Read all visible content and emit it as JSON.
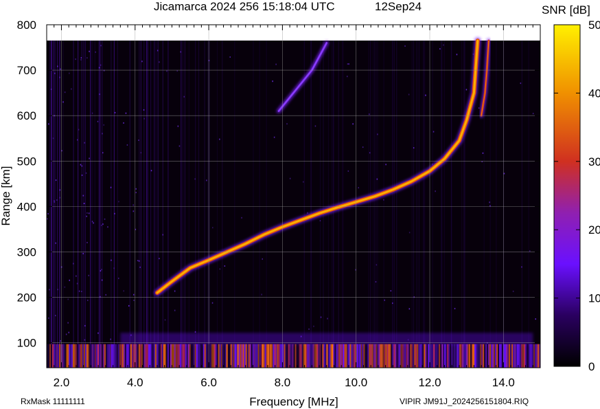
{
  "header": {
    "title": "Jicamarca 2024 256 15:18:04 UTC",
    "date": "12Sep24"
  },
  "footer": {
    "left": "RxMask 11111111",
    "right": "VIPIR  JM91J_2024256151804.RIQ"
  },
  "colorbar": {
    "label": "SNR [dB]",
    "range": [
      0,
      50
    ],
    "ticks": [
      "0",
      "10",
      "20",
      "30",
      "40",
      "50"
    ],
    "colors": [
      "#000000",
      "#2a0060",
      "#6a10ff",
      "#9020b0",
      "#d03020",
      "#f09000",
      "#fff000"
    ]
  },
  "chart_data": {
    "type": "heatmap",
    "title": "Jicamarca 2024 256 15:18:04 UTC",
    "xlabel": "Frequency [MHz]",
    "ylabel": "Range [km]",
    "xlim": [
      1.6,
      15.0
    ],
    "ylim": [
      45,
      800
    ],
    "x_ticks": [
      "2.0",
      "4.0",
      "6.0",
      "8.0",
      "10.0",
      "12.0",
      "14.0"
    ],
    "y_ticks": [
      "100",
      "200",
      "300",
      "400",
      "500",
      "600",
      "700",
      "800"
    ],
    "grid": true,
    "o_trace": {
      "x": [
        4.6,
        5.0,
        5.5,
        6.0,
        6.5,
        7.0,
        7.5,
        8.0,
        8.5,
        9.0,
        9.5,
        10.0,
        10.5,
        11.0,
        11.5,
        12.0,
        12.4,
        12.8,
        13.0,
        13.2,
        13.3
      ],
      "y": [
        210,
        235,
        265,
        282,
        300,
        318,
        338,
        355,
        370,
        385,
        398,
        410,
        422,
        437,
        455,
        478,
        505,
        545,
        590,
        650,
        765
      ]
    },
    "x_trace": {
      "x": [
        13.4,
        13.5,
        13.55,
        13.6
      ],
      "y": [
        600,
        650,
        700,
        765
      ]
    },
    "multihop_trace": {
      "x": [
        7.9,
        8.3,
        8.8,
        9.2
      ],
      "y": [
        610,
        650,
        700,
        760
      ]
    }
  }
}
